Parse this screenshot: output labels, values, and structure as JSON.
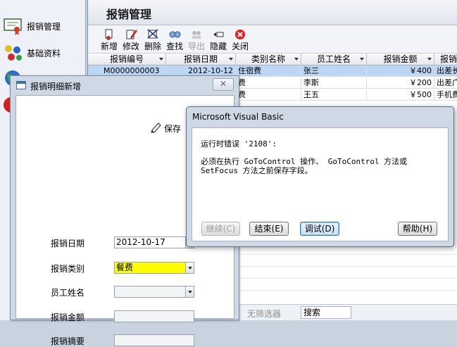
{
  "sidebar": {
    "items": [
      {
        "label": "报销管理",
        "icon": "certificate-icon"
      },
      {
        "label": "基础资料",
        "icon": "molecules-icon"
      },
      {
        "label": "",
        "icon": "globe-icon"
      },
      {
        "label": "",
        "icon": "stop-icon"
      }
    ]
  },
  "main": {
    "title": "报销管理",
    "toolbar": [
      {
        "label": "新增",
        "icon": "new-icon",
        "enabled": true
      },
      {
        "label": "修改",
        "icon": "edit-icon",
        "enabled": true
      },
      {
        "label": "删除",
        "icon": "delete-icon",
        "enabled": true
      },
      {
        "label": "查找",
        "icon": "find-icon",
        "enabled": true
      },
      {
        "label": "导出",
        "icon": "export-icon",
        "enabled": false
      },
      {
        "label": "隐藏",
        "icon": "hide-icon",
        "enabled": true
      },
      {
        "label": "关闭",
        "icon": "close-icon",
        "enabled": true
      }
    ],
    "grid": {
      "columns": [
        "报销编号",
        "报销日期",
        "类别名称",
        "员工姓名",
        "报销金额",
        "报销"
      ],
      "rows": [
        [
          "M0000000003",
          "2012-10-12",
          "住宿费",
          "张三",
          "￥400",
          "出差长"
        ],
        [
          "",
          "",
          "费",
          "李斯",
          "￥200",
          "出差广"
        ],
        [
          "",
          "",
          "费",
          "王五",
          "￥500",
          "手机费"
        ]
      ]
    },
    "filterbar": {
      "no_filter_label": "无筛选器",
      "search_label": "搜索"
    }
  },
  "detail_form": {
    "title": "报销明细新增",
    "close_glyph": "✕",
    "save_label": "保存",
    "fields": [
      {
        "label": "报销日期",
        "value": "2012-10-17"
      },
      {
        "label": "报销类别",
        "value": "餐费"
      },
      {
        "label": "员工姓名",
        "value": ""
      },
      {
        "label": "报销金额",
        "value": ""
      },
      {
        "label": "报销摘要",
        "value": ""
      }
    ]
  },
  "vb_dialog": {
    "title": "Microsoft Visual Basic",
    "line1": "运行时错误 '2108':",
    "line2": "必须在执行 GoToControl 操作、 GoToControl 方法或",
    "line3": "SetFocus 方法之前保存字段。",
    "buttons": {
      "continue": "继续(C)",
      "end": "结束(E)",
      "debug": "调试(D)",
      "help": "帮助(H)"
    }
  },
  "colors": {
    "selected_row": "#bcd6f3",
    "required_field": "#ffff00",
    "dialog_frame": "#cfd9e6"
  }
}
